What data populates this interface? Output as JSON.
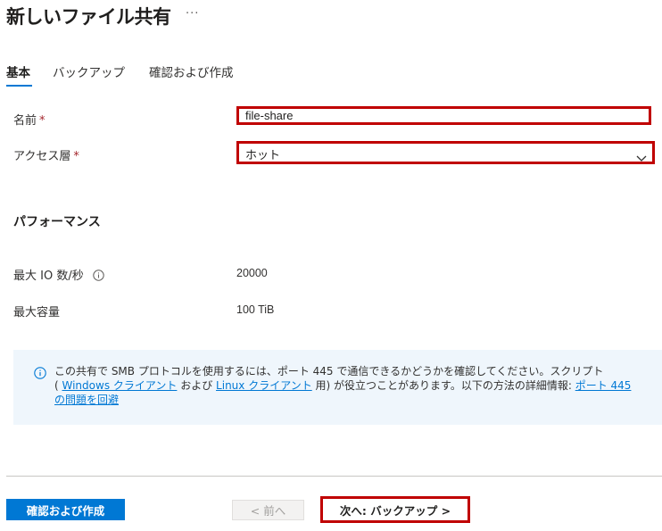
{
  "header": {
    "title": "新しいファイル共有",
    "more_label": "···"
  },
  "tabs": [
    {
      "label": "基本",
      "active": true
    },
    {
      "label": "バックアップ",
      "active": false
    },
    {
      "label": "確認および作成",
      "active": false
    }
  ],
  "form": {
    "name_label": "名前",
    "name_value": "file-share",
    "required_marker": "*",
    "access_tier_label": "アクセス層",
    "access_tier_value": "ホット"
  },
  "performance": {
    "section_title": "パフォーマンス",
    "max_io_label": "最大 IO 数/秒",
    "max_io_value": "20000",
    "capacity_label": "最大容量",
    "capacity_value": "100 TiB"
  },
  "info": {
    "text_1": "この共有で SMB プロトコルを使用するには、ポート 445 で通信できるかどうかを確認してください。スクリプト",
    "text_2": "( ",
    "link_windows": "Windows クライアント",
    "text_3": " および ",
    "link_linux": "Linux クライアント",
    "text_4": " 用) が役立つことがあります。以下の方法の詳細情報: ",
    "link_port": "ポート 445 の問題を回避"
  },
  "footer": {
    "review_create_label": "確認および作成",
    "prev_label": "< 前へ",
    "next_label": "次へ: バックアップ >"
  },
  "colors": {
    "accent": "#0078d4",
    "highlight_border": "#c00000",
    "required": "#a4262c",
    "info_background": "#eff6fc"
  }
}
